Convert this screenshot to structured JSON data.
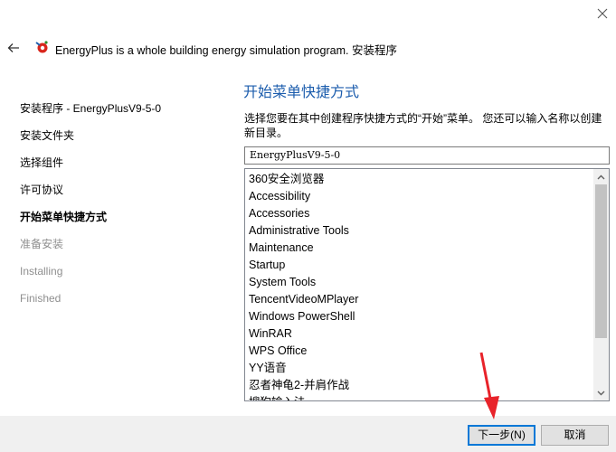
{
  "window": {
    "title": "EnergyPlus is a whole building energy simulation program. 安装程序",
    "close_icon": "close-icon",
    "back_icon": "back-arrow-icon",
    "app_icon": "energyplus-app-icon"
  },
  "steps": [
    {
      "label": "安装程序 - EnergyPlusV9-5-0",
      "state": "done"
    },
    {
      "label": "安装文件夹",
      "state": "done"
    },
    {
      "label": "选择组件",
      "state": "done"
    },
    {
      "label": "许可协议",
      "state": "done"
    },
    {
      "label": "开始菜单快捷方式",
      "state": "active"
    },
    {
      "label": "准备安装",
      "state": "pending"
    },
    {
      "label": "Installing",
      "state": "pending"
    },
    {
      "label": "Finished",
      "state": "pending"
    }
  ],
  "main": {
    "heading": "开始菜单快捷方式",
    "description": "选择您要在其中创建程序快捷方式的“开始”菜单。 您还可以输入名称以创建新目录。",
    "folder_value": "EnergyPlusV9-5-0",
    "folders": [
      "360安全浏览器",
      "Accessibility",
      "Accessories",
      "Administrative Tools",
      "Maintenance",
      "Startup",
      "System Tools",
      "TencentVideoMPlayer",
      "Windows PowerShell",
      "WinRAR",
      "WPS Office",
      "YY语音",
      "忍者神龟2-并肩作战",
      "搜狗输入法"
    ]
  },
  "buttons": {
    "next": "下一步(N)",
    "cancel": "取消"
  },
  "colors": {
    "heading": "#1c5dad",
    "pending_step": "#8f8f8f",
    "footer_bg": "#f0f0f0",
    "annotation_arrow": "#e8232a"
  }
}
